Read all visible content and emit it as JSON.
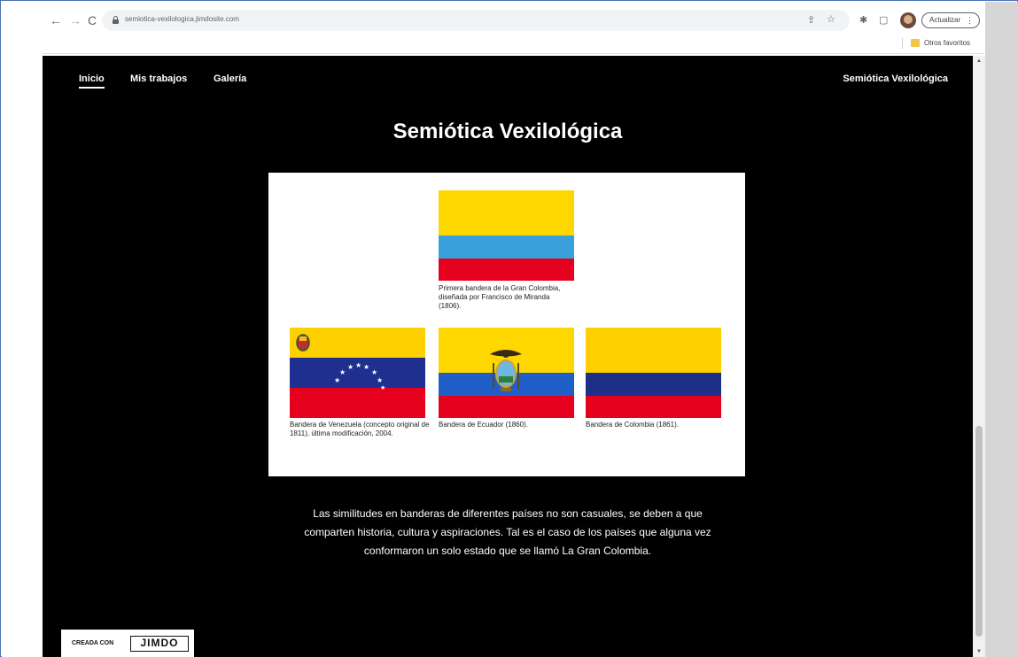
{
  "browser": {
    "url": "semiotica-vexilologica.jimdosite.com",
    "update_label": "Actualizar",
    "bookmark_folder": "Otros favoritos"
  },
  "nav": {
    "items": [
      {
        "label": "Inicio"
      },
      {
        "label": "Mis trabajos"
      },
      {
        "label": "Galería"
      }
    ],
    "site_name": "Semiótica Vexilológica"
  },
  "main": {
    "title": "Semiótica Vexilológica",
    "flags": [
      {
        "caption": "Primera bandera de la Gran Colombia, diseñada por Francisco de Miranda (1806).",
        "colors": [
          "#ffd700",
          "#3aa0dc",
          "#e5001e"
        ]
      },
      {
        "caption": "Bandera de Venezuela (concepto original de 1811), última modificación, 2004.",
        "colors": [
          "#ffd000",
          "#1f2f8f",
          "#e5001e"
        ]
      },
      {
        "caption": "Bandera de Ecuador (1860).",
        "colors": [
          "#ffd700",
          "#1f5fc7",
          "#e5001e"
        ]
      },
      {
        "caption": "Bandera de Colombia (1861).",
        "colors": [
          "#ffd000",
          "#1e2f88",
          "#e5001e"
        ]
      }
    ],
    "body_lines": [
      "Las similitudes en banderas de diferentes países no son casuales, se deben a que",
      "comparten historia, cultura y aspiraciones. Tal es el caso de los países que alguna vez",
      "conformaron un solo estado que se llamó La Gran Colombia."
    ]
  },
  "footer": {
    "created_with": "CREADA CON",
    "brand": "JIMDO"
  }
}
